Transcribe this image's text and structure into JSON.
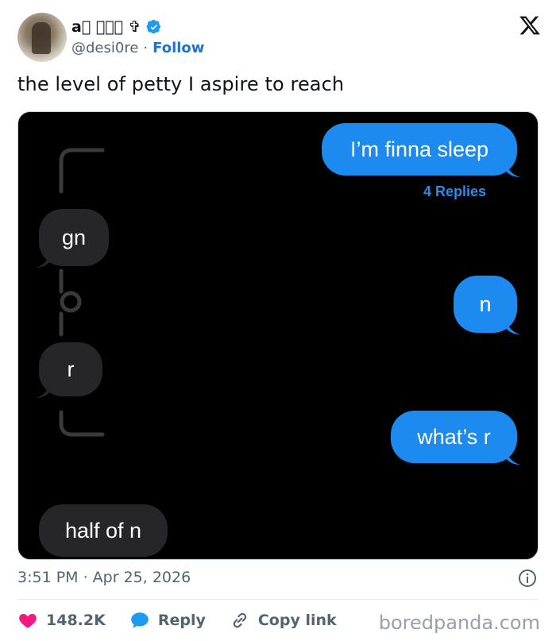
{
  "author": {
    "name": "a\u0000 \u0000\u0000\u0000 ✞",
    "handle": "@desi0re",
    "separator": "·",
    "follow_label": "Follow"
  },
  "tweet": {
    "text": "the level of petty I aspire to reach",
    "time": "3:51 PM · Apr 25, 2026"
  },
  "media": {
    "messages": [
      {
        "side": "right",
        "text": "I’m finna sleep"
      },
      {
        "side": "left",
        "text": "gn"
      },
      {
        "side": "right",
        "text": "n"
      },
      {
        "side": "left",
        "text": "r"
      },
      {
        "side": "right",
        "text": "what’s r"
      },
      {
        "side": "left",
        "text": "half of n"
      }
    ],
    "replies_label": "4 Replies"
  },
  "actions": {
    "like_count": "148.2K",
    "reply_label": "Reply",
    "copy_label": "Copy link"
  },
  "watermark": "boredpanda.com",
  "colors": {
    "accent": "#1d9bf0",
    "bubble_blue": "#1d8af0",
    "bubble_gray": "#262628",
    "like_red": "#f91880"
  }
}
